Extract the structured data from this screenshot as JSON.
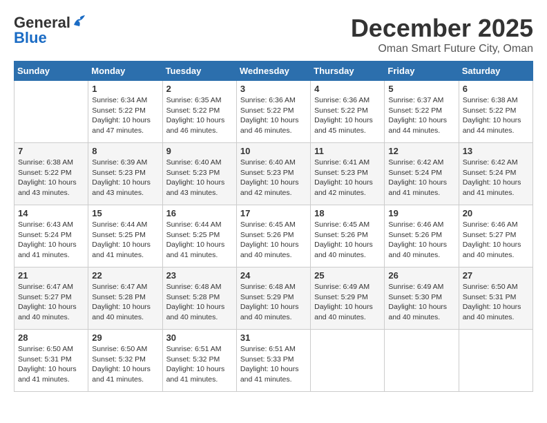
{
  "logo": {
    "text_general": "General",
    "text_blue": "Blue"
  },
  "header": {
    "month": "December 2025",
    "location": "Oman Smart Future City, Oman"
  },
  "days_of_week": [
    "Sunday",
    "Monday",
    "Tuesday",
    "Wednesday",
    "Thursday",
    "Friday",
    "Saturday"
  ],
  "weeks": [
    [
      {
        "day": "",
        "info": ""
      },
      {
        "day": "1",
        "info": "Sunrise: 6:34 AM\nSunset: 5:22 PM\nDaylight: 10 hours\nand 47 minutes."
      },
      {
        "day": "2",
        "info": "Sunrise: 6:35 AM\nSunset: 5:22 PM\nDaylight: 10 hours\nand 46 minutes."
      },
      {
        "day": "3",
        "info": "Sunrise: 6:36 AM\nSunset: 5:22 PM\nDaylight: 10 hours\nand 46 minutes."
      },
      {
        "day": "4",
        "info": "Sunrise: 6:36 AM\nSunset: 5:22 PM\nDaylight: 10 hours\nand 45 minutes."
      },
      {
        "day": "5",
        "info": "Sunrise: 6:37 AM\nSunset: 5:22 PM\nDaylight: 10 hours\nand 44 minutes."
      },
      {
        "day": "6",
        "info": "Sunrise: 6:38 AM\nSunset: 5:22 PM\nDaylight: 10 hours\nand 44 minutes."
      }
    ],
    [
      {
        "day": "7",
        "info": "Sunrise: 6:38 AM\nSunset: 5:22 PM\nDaylight: 10 hours\nand 43 minutes."
      },
      {
        "day": "8",
        "info": "Sunrise: 6:39 AM\nSunset: 5:23 PM\nDaylight: 10 hours\nand 43 minutes."
      },
      {
        "day": "9",
        "info": "Sunrise: 6:40 AM\nSunset: 5:23 PM\nDaylight: 10 hours\nand 43 minutes."
      },
      {
        "day": "10",
        "info": "Sunrise: 6:40 AM\nSunset: 5:23 PM\nDaylight: 10 hours\nand 42 minutes."
      },
      {
        "day": "11",
        "info": "Sunrise: 6:41 AM\nSunset: 5:23 PM\nDaylight: 10 hours\nand 42 minutes."
      },
      {
        "day": "12",
        "info": "Sunrise: 6:42 AM\nSunset: 5:24 PM\nDaylight: 10 hours\nand 41 minutes."
      },
      {
        "day": "13",
        "info": "Sunrise: 6:42 AM\nSunset: 5:24 PM\nDaylight: 10 hours\nand 41 minutes."
      }
    ],
    [
      {
        "day": "14",
        "info": "Sunrise: 6:43 AM\nSunset: 5:24 PM\nDaylight: 10 hours\nand 41 minutes."
      },
      {
        "day": "15",
        "info": "Sunrise: 6:44 AM\nSunset: 5:25 PM\nDaylight: 10 hours\nand 41 minutes."
      },
      {
        "day": "16",
        "info": "Sunrise: 6:44 AM\nSunset: 5:25 PM\nDaylight: 10 hours\nand 41 minutes."
      },
      {
        "day": "17",
        "info": "Sunrise: 6:45 AM\nSunset: 5:26 PM\nDaylight: 10 hours\nand 40 minutes."
      },
      {
        "day": "18",
        "info": "Sunrise: 6:45 AM\nSunset: 5:26 PM\nDaylight: 10 hours\nand 40 minutes."
      },
      {
        "day": "19",
        "info": "Sunrise: 6:46 AM\nSunset: 5:26 PM\nDaylight: 10 hours\nand 40 minutes."
      },
      {
        "day": "20",
        "info": "Sunrise: 6:46 AM\nSunset: 5:27 PM\nDaylight: 10 hours\nand 40 minutes."
      }
    ],
    [
      {
        "day": "21",
        "info": "Sunrise: 6:47 AM\nSunset: 5:27 PM\nDaylight: 10 hours\nand 40 minutes."
      },
      {
        "day": "22",
        "info": "Sunrise: 6:47 AM\nSunset: 5:28 PM\nDaylight: 10 hours\nand 40 minutes."
      },
      {
        "day": "23",
        "info": "Sunrise: 6:48 AM\nSunset: 5:28 PM\nDaylight: 10 hours\nand 40 minutes."
      },
      {
        "day": "24",
        "info": "Sunrise: 6:48 AM\nSunset: 5:29 PM\nDaylight: 10 hours\nand 40 minutes."
      },
      {
        "day": "25",
        "info": "Sunrise: 6:49 AM\nSunset: 5:29 PM\nDaylight: 10 hours\nand 40 minutes."
      },
      {
        "day": "26",
        "info": "Sunrise: 6:49 AM\nSunset: 5:30 PM\nDaylight: 10 hours\nand 40 minutes."
      },
      {
        "day": "27",
        "info": "Sunrise: 6:50 AM\nSunset: 5:31 PM\nDaylight: 10 hours\nand 40 minutes."
      }
    ],
    [
      {
        "day": "28",
        "info": "Sunrise: 6:50 AM\nSunset: 5:31 PM\nDaylight: 10 hours\nand 41 minutes."
      },
      {
        "day": "29",
        "info": "Sunrise: 6:50 AM\nSunset: 5:32 PM\nDaylight: 10 hours\nand 41 minutes."
      },
      {
        "day": "30",
        "info": "Sunrise: 6:51 AM\nSunset: 5:32 PM\nDaylight: 10 hours\nand 41 minutes."
      },
      {
        "day": "31",
        "info": "Sunrise: 6:51 AM\nSunset: 5:33 PM\nDaylight: 10 hours\nand 41 minutes."
      },
      {
        "day": "",
        "info": ""
      },
      {
        "day": "",
        "info": ""
      },
      {
        "day": "",
        "info": ""
      }
    ]
  ]
}
